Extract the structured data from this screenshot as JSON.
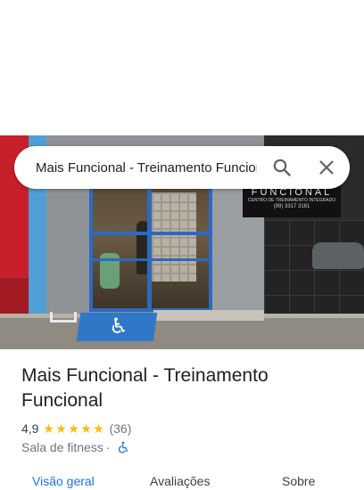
{
  "search": {
    "value": "Mais Funcional - Treinamento Funcional"
  },
  "photo": {
    "sign_line1": "FUNCIONAL",
    "sign_line2": "CENTRO DE TREINAMENTO INTEGRADO",
    "sign_line3": "(99) 3317 3161"
  },
  "place": {
    "title": "Mais Funcional - Treinamento Funcional",
    "rating": "4,9",
    "stars": 5,
    "review_count": "(36)",
    "category": "Sala de fitness",
    "separator": "·",
    "wheelchair_accessible": true
  },
  "tabs": [
    {
      "label": "Visão geral",
      "active": true
    },
    {
      "label": "Avaliações",
      "active": false
    },
    {
      "label": "Sobre",
      "active": false
    }
  ],
  "colors": {
    "accent": "#1a73e8",
    "star": "#fbbc04",
    "text_primary": "#202124",
    "text_secondary": "#70757a"
  }
}
